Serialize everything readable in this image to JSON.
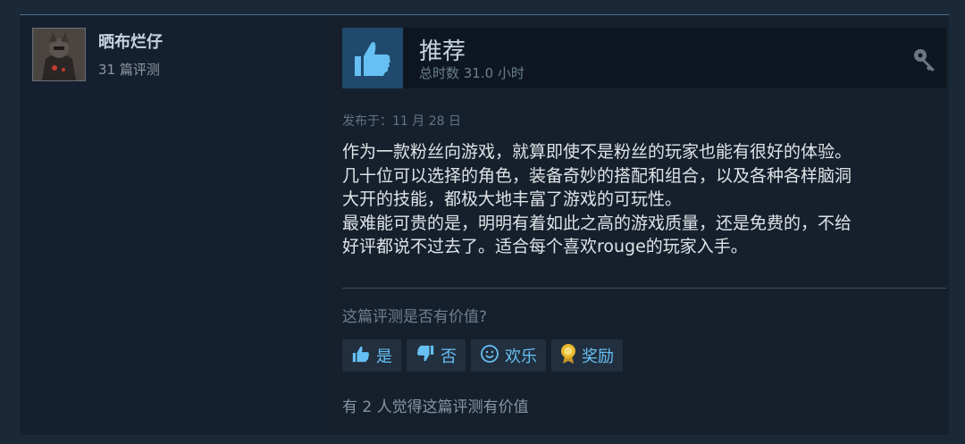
{
  "author": {
    "name": "晒布烂仔",
    "reviews": "31 篇评测"
  },
  "review": {
    "verdict": "推荐",
    "hours": "总时数 31.0 小时",
    "posted": "发布于：11 月 28 日",
    "text": "作为一款粉丝向游戏，就算即使不是粉丝的玩家也能有很好的体验。\n几十位可以选择的角色，装备奇妙的搭配和组合，以及各种各样脑洞\n大开的技能，都极大地丰富了游戏的可玩性。\n最难能可贵的是，明明有着如此之高的游戏质量，还是免费的，不给\n好评都说不过去了。适合每个喜欢rouge的玩家入手。"
  },
  "feedback": {
    "question": "这篇评测是否有价值?",
    "yes_label": "是",
    "no_label": "否",
    "funny_label": "欢乐",
    "award_label": "奖励",
    "helpful_count": "有 2 人觉得这篇评测有价值"
  },
  "icons": {
    "thumb": "thumbs-up-icon",
    "key": "key-icon",
    "yes": "thumbs-up-icon",
    "no": "thumbs-down-icon",
    "funny": "smile-icon",
    "award": "award-icon"
  },
  "colors": {
    "background": "#1b2838",
    "accent": "#66c0f4",
    "thumb_box": "#1f4a6d",
    "award_gold": "#e8b92c"
  }
}
